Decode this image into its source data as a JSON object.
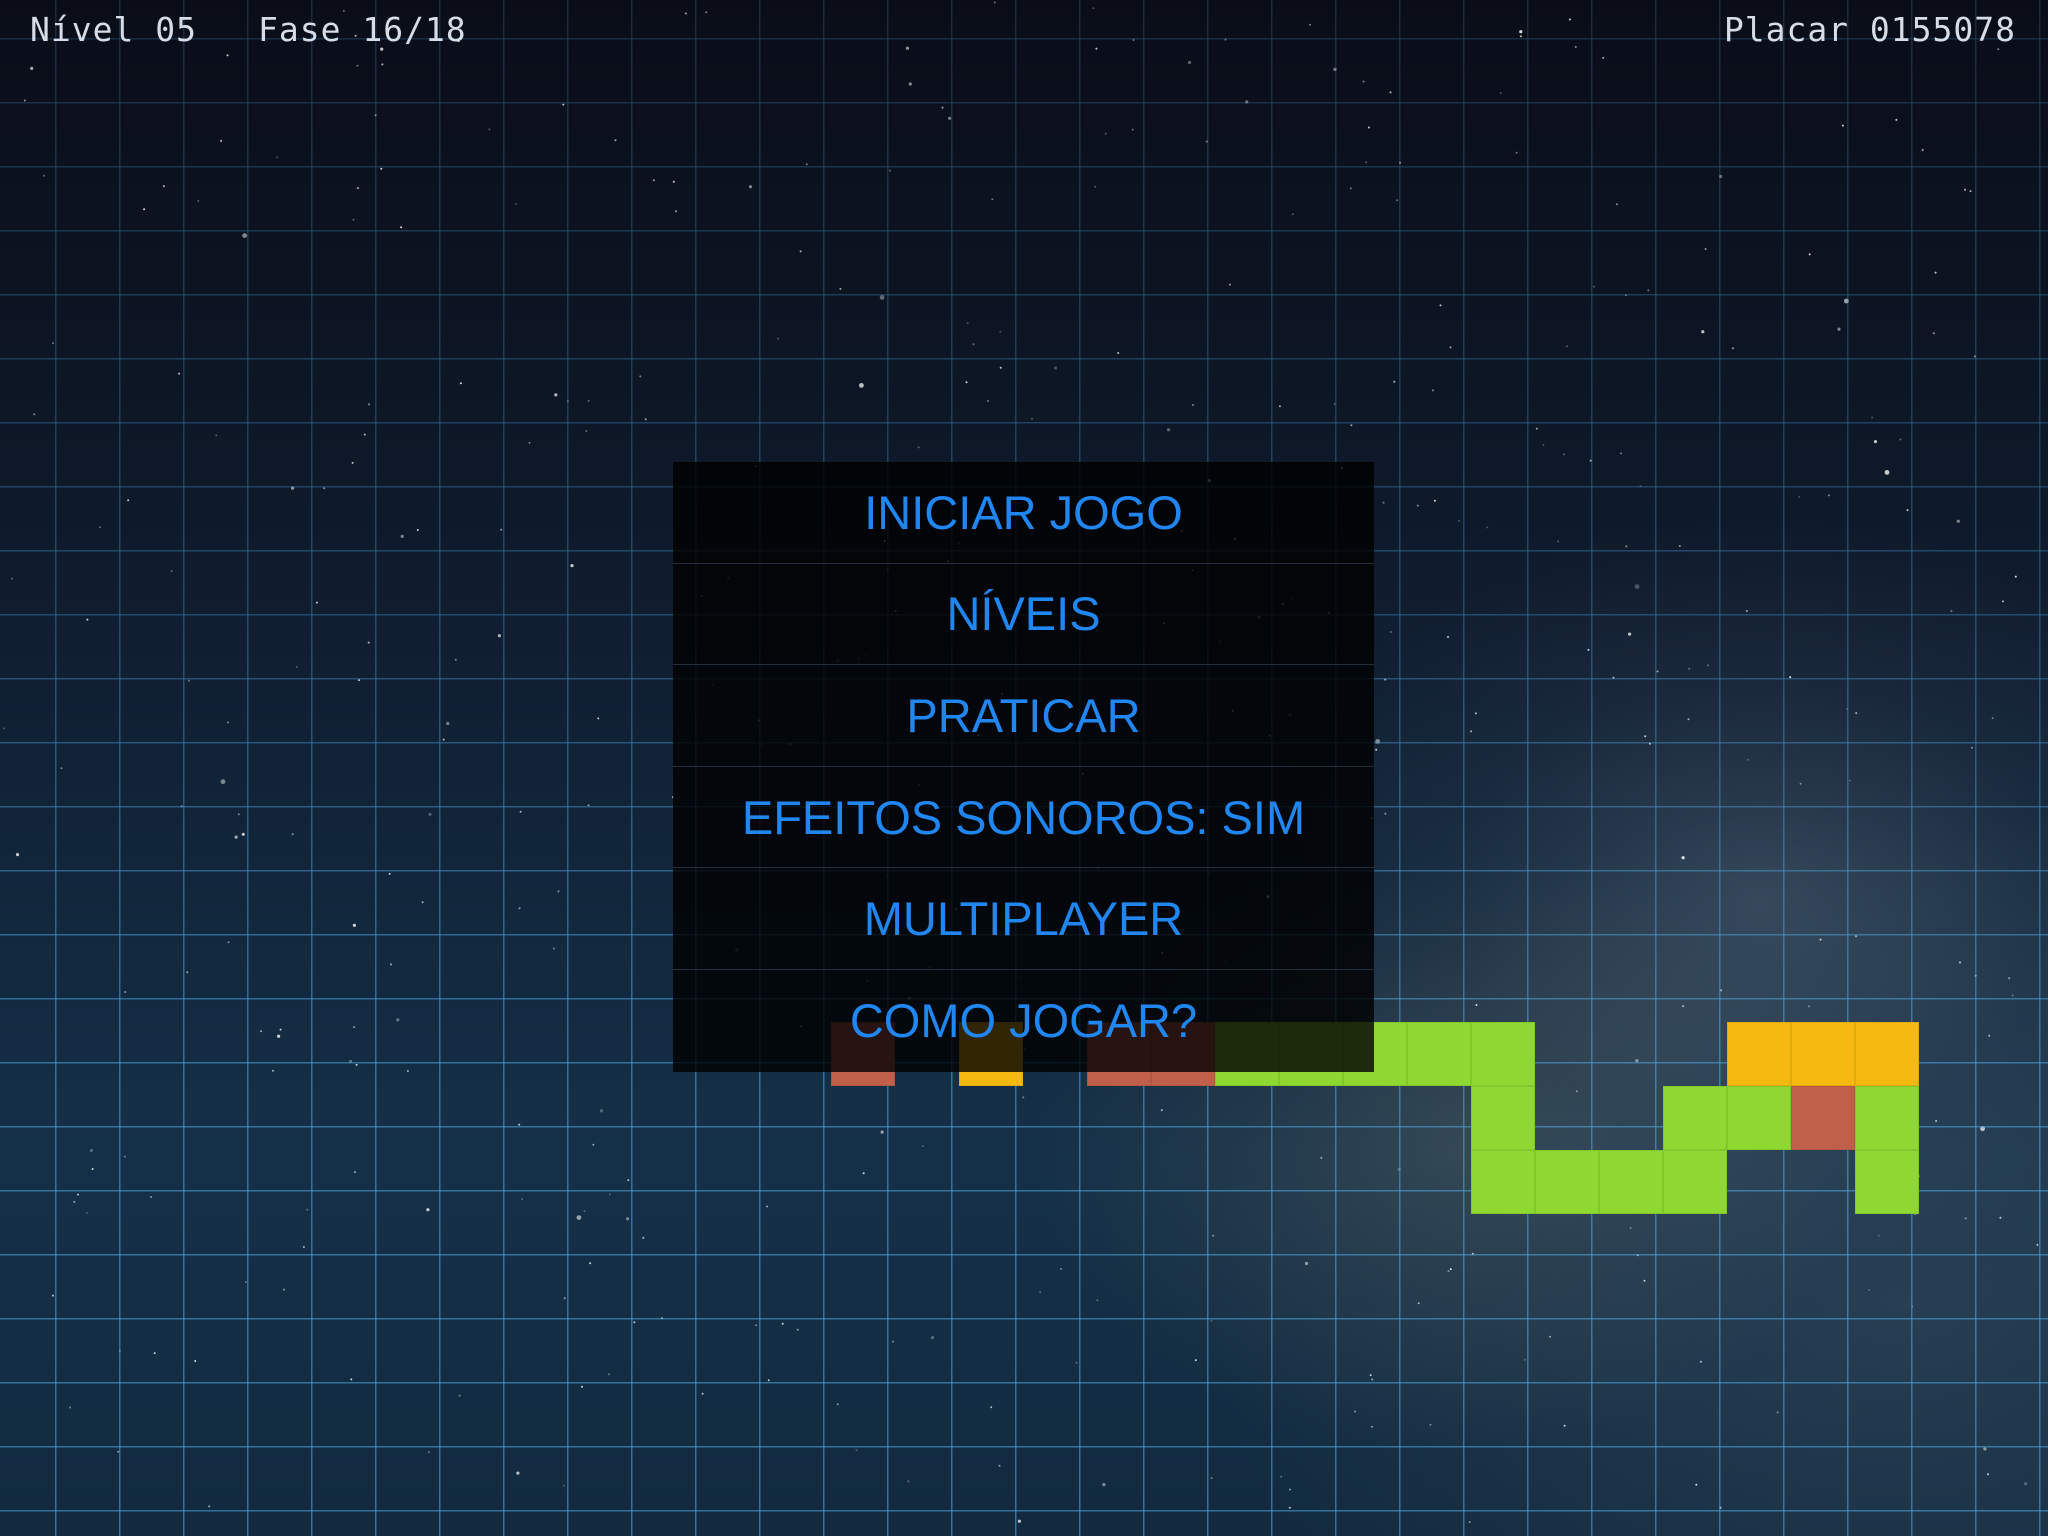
{
  "hud": {
    "level_label": "Nível 05",
    "phase_label": "Fase 16/18",
    "score_label": "Placar 0155078"
  },
  "menu": {
    "items": [
      {
        "label": "INICIAR JOGO"
      },
      {
        "label": "NÍVEIS"
      },
      {
        "label": "PRATICAR"
      },
      {
        "label": "EFEITOS SONOROS: SIM"
      },
      {
        "label": "MULTIPLAYER"
      },
      {
        "label": "COMO JOGAR?"
      }
    ]
  },
  "colors": {
    "menu_text": "#1f86f2",
    "grid_line": "#50aae6",
    "block_green": "#8fd832",
    "block_yellow": "#f5b90f",
    "block_red": "#c0604a"
  },
  "board": {
    "cells": [
      {
        "row": 0,
        "col": 0,
        "color": "red"
      },
      {
        "row": 0,
        "col": 2,
        "color": "yellow"
      },
      {
        "row": 0,
        "col": 4,
        "color": "red"
      },
      {
        "row": 0,
        "col": 5,
        "color": "red"
      },
      {
        "row": 0,
        "col": 6,
        "color": "green"
      },
      {
        "row": 0,
        "col": 7,
        "color": "green"
      },
      {
        "row": 0,
        "col": 8,
        "color": "green"
      },
      {
        "row": 0,
        "col": 9,
        "color": "green"
      },
      {
        "row": 0,
        "col": 10,
        "color": "green"
      },
      {
        "row": 0,
        "col": 14,
        "color": "yellow"
      },
      {
        "row": 0,
        "col": 15,
        "color": "yellow"
      },
      {
        "row": 0,
        "col": 16,
        "color": "yellow"
      },
      {
        "row": 1,
        "col": 10,
        "color": "green"
      },
      {
        "row": 1,
        "col": 13,
        "color": "green"
      },
      {
        "row": 1,
        "col": 14,
        "color": "green"
      },
      {
        "row": 1,
        "col": 15,
        "color": "red"
      },
      {
        "row": 1,
        "col": 16,
        "color": "green"
      },
      {
        "row": 2,
        "col": 10,
        "color": "green"
      },
      {
        "row": 2,
        "col": 11,
        "color": "green"
      },
      {
        "row": 2,
        "col": 12,
        "color": "green"
      },
      {
        "row": 2,
        "col": 13,
        "color": "green"
      },
      {
        "row": 2,
        "col": 16,
        "color": "green"
      }
    ]
  }
}
